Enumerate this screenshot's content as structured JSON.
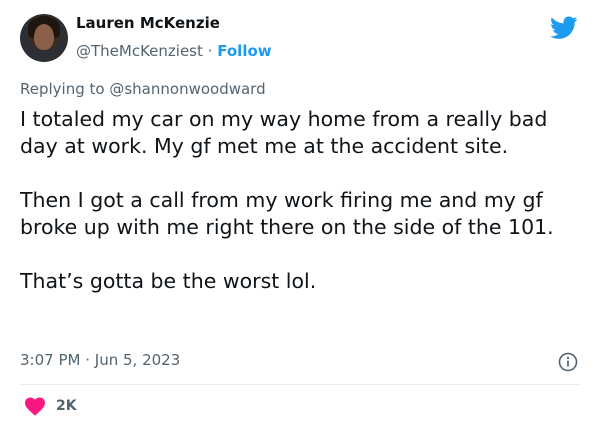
{
  "author": {
    "name": "Lauren McKenzie",
    "handle": "@TheMcKenziest",
    "separator": "·",
    "follow_label": "Follow"
  },
  "reply": {
    "prefix": "Replying to",
    "mention": "@shannonwoodward"
  },
  "tweet": {
    "paragraphs": [
      "I totaled my car on my way home from a really bad day at work. My gf met me at the accident site.",
      "Then I got a call from my work firing me and my gf broke up with me right there on the side of the 101.",
      "That’s gotta be the worst lol."
    ],
    "time": "3:07 PM",
    "separator": "·",
    "date": "Jun 5, 2023"
  },
  "engagement": {
    "likes": "2K"
  },
  "icons": {
    "logo": "twitter-bird-icon",
    "info": "info-icon",
    "like": "heart-icon"
  },
  "colors": {
    "accent": "#1d9bf0",
    "like": "#f91880",
    "secondary_text": "#536471"
  }
}
